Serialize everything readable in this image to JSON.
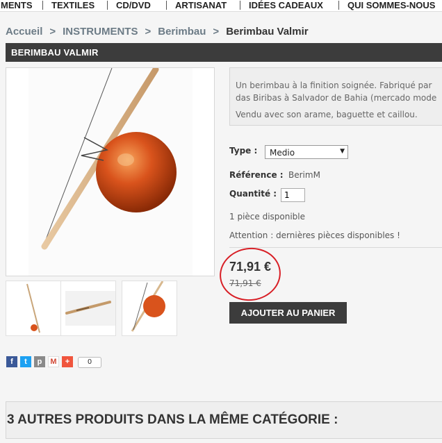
{
  "nav": [
    "MENTS",
    "TEXTILES",
    "CD/DVD",
    "ARTISANAT",
    "IDÉES CADEAUX",
    "QUI SOMMES-NOUS"
  ],
  "breadcrumb": {
    "home": "Accueil",
    "sep": ">",
    "category": "INSTRUMENTS",
    "subcategory": "Berimbau",
    "current": "Berimbau Valmir"
  },
  "product": {
    "title": "BERIMBAU VALMIR",
    "description": [
      "Un berimbau à la finition soignée. Fabriqué par",
      "das Biribas à Salvador de Bahia (mercado mode",
      "Vendu avec son arame, baguette et caillou."
    ],
    "type_label": "Type :",
    "type_value": "Medio",
    "reference_label": "Référence :",
    "reference_value": "BerimM",
    "quantity_label": "Quantité :",
    "quantity_value": "1",
    "stock": "1 pièce disponible",
    "warning": "Attention : dernières pièces disponibles !",
    "price": "71,91 €",
    "old_price": "71,91 €",
    "add_to_cart": "AJOUTER AU PANIER"
  },
  "share": {
    "facebook": "f",
    "twitter": "t",
    "print": "p",
    "gmail": "M",
    "more": "+",
    "count": "0"
  },
  "related_title": "3 AUTRES PRODUITS DANS LA MÊME CATÉGORIE :",
  "colors": {
    "dark_bar": "#3c3c3c",
    "breadcrumb_link": "#6c7b86",
    "annotation_circle": "#d81f26",
    "calabash": "#d9531c"
  }
}
